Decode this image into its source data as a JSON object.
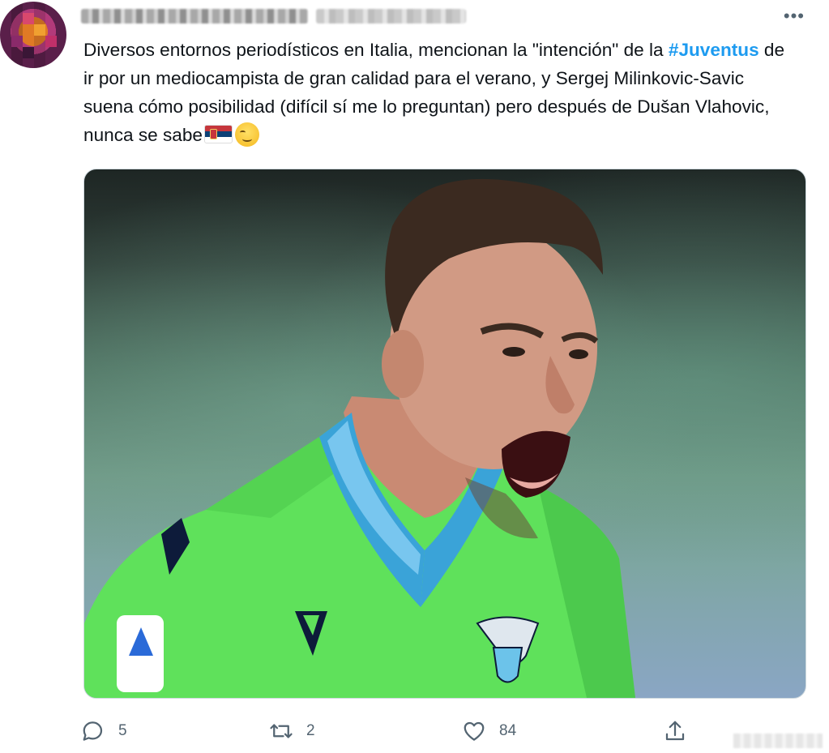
{
  "tweet": {
    "text_part1": "Diversos entornos periodísticos en Italia, mencionan la \"intención\" de la ",
    "hashtag": "#Juventus",
    "text_part2": " de ir por un mediocampista de gran calidad para el verano, y Sergej Milinkovic-Savic suena cómo posibilidad (difícil sí me lo preguntan) pero después de Dušan Vlahovic, nunca se sabe",
    "more_label": "•••",
    "emojis": [
      "serbia-flag-emoji",
      "relieved-face-emoji"
    ]
  },
  "actions": {
    "reply_count": "5",
    "retweet_count": "2",
    "like_count": "84"
  },
  "icons": {
    "reply": "reply-icon",
    "retweet": "retweet-icon",
    "like": "heart-icon",
    "share": "share-icon"
  },
  "colors": {
    "text": "#0f1419",
    "secondary": "#536471",
    "hashtag": "#1d9bf0",
    "jersey": "#5ee05a"
  }
}
